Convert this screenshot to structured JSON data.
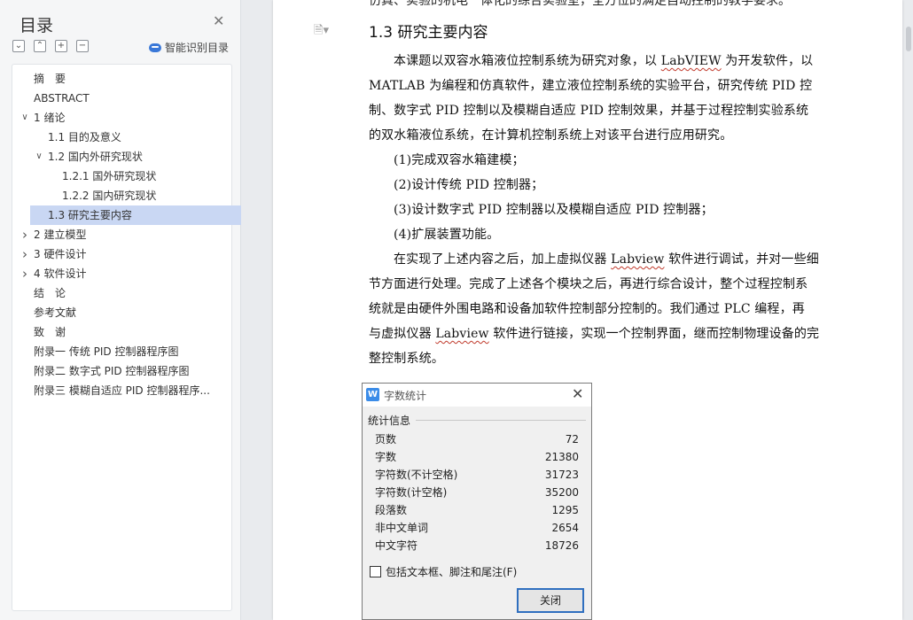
{
  "toc": {
    "title": "目录",
    "smart_label": "智能识别目录",
    "tools": [
      "expand-all",
      "collapse",
      "add",
      "remove"
    ],
    "tool_glyphs": [
      "⌄",
      "⌃",
      "+",
      "−"
    ],
    "items": [
      {
        "label": "摘　要",
        "level": 1,
        "arrow": ""
      },
      {
        "label": "ABSTRACT",
        "level": 1,
        "arrow": ""
      },
      {
        "label": "1 绪论",
        "level": 1,
        "arrow": "expanded"
      },
      {
        "label": "1.1  目的及意义",
        "level": 2,
        "arrow": ""
      },
      {
        "label": "1.2  国内外研究现状",
        "level": 2,
        "arrow": "expanded"
      },
      {
        "label": "1.2.1  国外研究现状",
        "level": 3,
        "arrow": ""
      },
      {
        "label": "1.2.2  国内研究现状",
        "level": 3,
        "arrow": ""
      },
      {
        "label": "1.3 研究主要内容",
        "level": 2,
        "arrow": "",
        "selected": true
      },
      {
        "label": "2 建立模型",
        "level": 1,
        "arrow": "collapsed"
      },
      {
        "label": "3 硬件设计",
        "level": 1,
        "arrow": "collapsed"
      },
      {
        "label": "4 软件设计",
        "level": 1,
        "arrow": "collapsed"
      },
      {
        "label": "结　论",
        "level": 1,
        "arrow": ""
      },
      {
        "label": "参考文献",
        "level": 1,
        "arrow": ""
      },
      {
        "label": "致　谢",
        "level": 1,
        "arrow": ""
      },
      {
        "label": "附录一  传统 PID 控制器程序图",
        "level": 1,
        "arrow": ""
      },
      {
        "label": "附录二  数字式 PID 控制器程序图",
        "level": 1,
        "arrow": ""
      },
      {
        "label": "附录三  模糊自适应 PID 控制器程序...",
        "level": 1,
        "arrow": ""
      }
    ]
  },
  "document": {
    "top_cut_text": "仿真、实验的机电一体化的综合实验室，全方位的满足自动控制的教学要求。",
    "heading": "1.3 研究主要内容",
    "lines": [
      {
        "parts": [
          "本课题以双容水箱液位控制系统为研究对象，以 ",
          "LabVIEW",
          " 为开发软件，以"
        ],
        "wavy": 1,
        "indent": true
      },
      {
        "parts": [
          "MATLAB 为编程和仿真软件，建立液位控制系统的实验平台，研究传统 PID 控"
        ]
      },
      {
        "parts": [
          "制、数字式 PID 控制以及模糊自适应 PID 控制效果，并基于过程控制实验系统"
        ]
      },
      {
        "parts": [
          "的双水箱液位系统，在计算机控制系统上对该平台进行应用研究。"
        ]
      },
      {
        "parts": [
          "(1)完成双容水箱建模；"
        ],
        "indent": true
      },
      {
        "parts": [
          "(2)设计传统 PID 控制器；"
        ],
        "indent": true
      },
      {
        "parts": [
          "(3)设计数字式 PID 控制器以及模糊自适应 PID 控制器；"
        ],
        "indent": true
      },
      {
        "parts": [
          "(4)扩展装置功能。"
        ],
        "indent": true
      },
      {
        "parts": [
          "在实现了上述内容之后，加上虚拟仪器 ",
          "Labview",
          " 软件进行调试，并对一些细"
        ],
        "wavy": 1,
        "indent": true
      },
      {
        "parts": [
          "节方面进行处理。完成了上述各个模块之后，再进行综合设计，整个过程控制系"
        ]
      },
      {
        "parts": [
          "统就是由硬件外围电路和设备加软件控制部分控制的。我们通过 PLC 编程，再"
        ]
      },
      {
        "parts": [
          "与虚拟仪器 ",
          "Labview",
          " 软件进行链接，实现一个控制界面，继而控制物理设备的完"
        ],
        "wavy": 1
      },
      {
        "parts": [
          "整控制系统。"
        ]
      }
    ]
  },
  "word_count_dialog": {
    "logo_letter": "W",
    "title": "字数统计",
    "group_label": "统计信息",
    "stats": [
      {
        "label": "页数",
        "value": "72"
      },
      {
        "label": "字数",
        "value": "21380"
      },
      {
        "label": "字符数(不计空格)",
        "value": "31723"
      },
      {
        "label": "字符数(计空格)",
        "value": "35200"
      },
      {
        "label": "段落数",
        "value": "1295"
      },
      {
        "label": "非中文单词",
        "value": "2654"
      },
      {
        "label": "中文字符",
        "value": "18726"
      }
    ],
    "checkbox_label": "包括文本框、脚注和尾注(F)",
    "checkbox_checked": false,
    "close_button": "关闭"
  }
}
